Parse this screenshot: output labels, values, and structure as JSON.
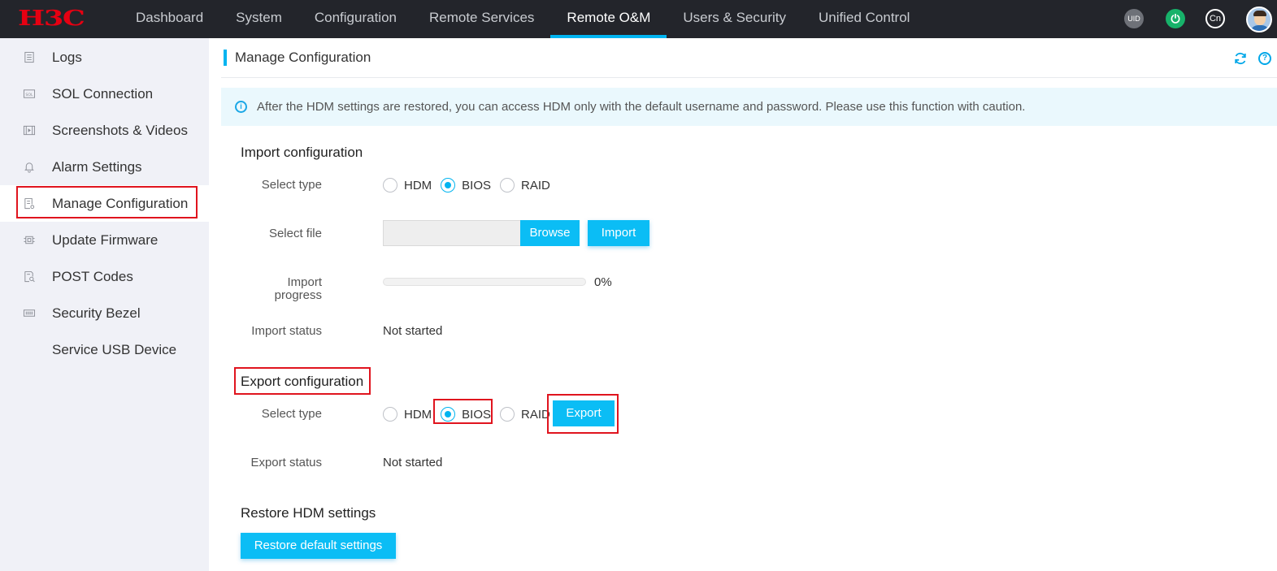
{
  "header": {
    "logo": "H3C",
    "nav": [
      {
        "label": "Dashboard"
      },
      {
        "label": "System"
      },
      {
        "label": "Configuration"
      },
      {
        "label": "Remote Services"
      },
      {
        "label": "Remote O&M",
        "active": true
      },
      {
        "label": "Users & Security"
      },
      {
        "label": "Unified Control"
      }
    ],
    "uid_label": "UID",
    "lang_label": "Cn",
    "accent_color": "#00b4f0"
  },
  "sidebar": {
    "items": [
      {
        "label": "Logs",
        "icon": "document-list-icon"
      },
      {
        "label": "SOL Connection",
        "icon": "sol-icon"
      },
      {
        "label": "Screenshots & Videos",
        "icon": "video-icon"
      },
      {
        "label": "Alarm Settings",
        "icon": "bell-icon"
      },
      {
        "label": "Manage Configuration",
        "icon": "config-file-icon",
        "active": true
      },
      {
        "label": "Update Firmware",
        "icon": "chip-icon"
      },
      {
        "label": "POST Codes",
        "icon": "document-search-icon"
      },
      {
        "label": "Security Bezel",
        "icon": "bezel-icon"
      },
      {
        "label": "Service USB Device",
        "icon": ""
      }
    ]
  },
  "main": {
    "title": "Manage Configuration",
    "notice": "After the HDM settings are restored, you can access HDM only with the default username and password. Please use this function with caution.",
    "import": {
      "section_title": "Import configuration",
      "select_type_label": "Select type",
      "types": [
        "HDM",
        "BIOS",
        "RAID"
      ],
      "selected_type": "BIOS",
      "select_file_label": "Select file",
      "browse_label": "Browse",
      "import_label": "Import",
      "progress_label_line1": "Import",
      "progress_label_line2": "progress",
      "progress_value": 0,
      "progress_text": "0%",
      "status_label": "Import status",
      "status_value": "Not started"
    },
    "export": {
      "section_title": "Export configuration",
      "select_type_label": "Select type",
      "types": [
        "HDM",
        "BIOS",
        "RAID"
      ],
      "selected_type": "BIOS",
      "export_label": "Export",
      "status_label": "Export status",
      "status_value": "Not started"
    },
    "restore": {
      "section_title": "Restore HDM settings",
      "button_label": "Restore default settings"
    }
  }
}
